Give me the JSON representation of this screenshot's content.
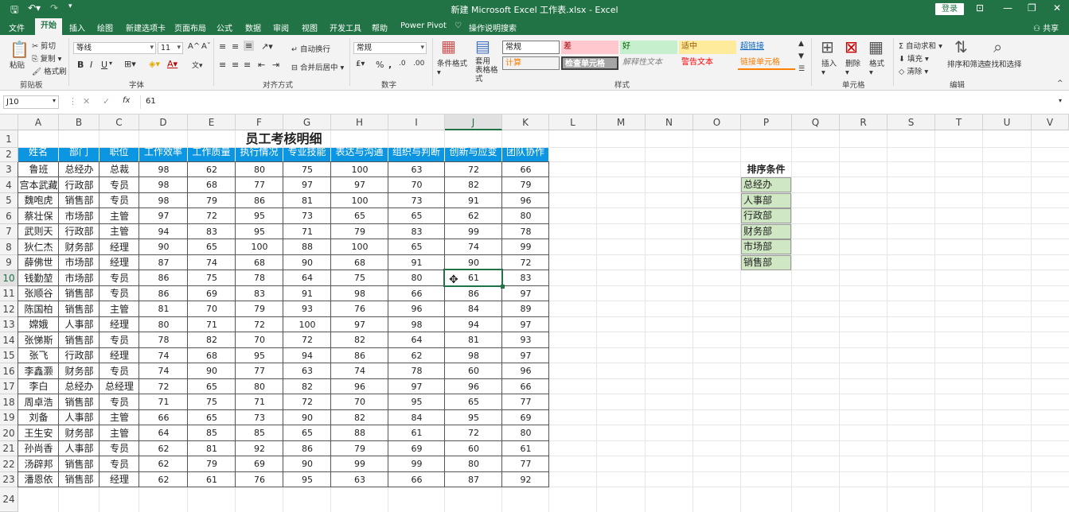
{
  "app": {
    "title": "新建 Microsoft Excel 工作表.xlsx - Excel",
    "signin": "登录",
    "share": "共享"
  },
  "menu": [
    "文件",
    "开始",
    "插入",
    "绘图",
    "新建选项卡",
    "页面布局",
    "公式",
    "数据",
    "审阅",
    "视图",
    "开发工具",
    "帮助",
    "Power Pivot",
    "操作说明搜索"
  ],
  "ribbon": {
    "clipboard": {
      "paste": "粘贴",
      "cut": "剪切",
      "copy": "复制",
      "painter": "格式刷",
      "label": "剪贴板"
    },
    "font": {
      "name": "等线",
      "size": "11",
      "label": "字体"
    },
    "align": {
      "wrap": "自动换行",
      "merge": "合并后居中",
      "label": "对齐方式"
    },
    "number": {
      "format": "常规",
      "label": "数字"
    },
    "styles": {
      "cond": "条件格式",
      "table": "套用\n表格格式",
      "cells": [
        "常规",
        "差",
        "好",
        "适中",
        "超链接",
        "计算",
        "检查单元格",
        "解释性文本",
        "警告文本",
        "链接单元格"
      ],
      "label": "样式"
    },
    "cellsgrp": {
      "insert": "插入",
      "delete": "删除",
      "format": "格式",
      "label": "单元格"
    },
    "editing": {
      "autosum": "自动求和",
      "fill": "填充",
      "clear": "清除",
      "sort": "排序和筛选",
      "find": "查找和选择",
      "label": "编辑"
    }
  },
  "namebox": "J10",
  "formula": "61",
  "columns": [
    "A",
    "B",
    "C",
    "D",
    "E",
    "F",
    "G",
    "H",
    "I",
    "J",
    "K",
    "L",
    "M",
    "N",
    "O",
    "P",
    "Q",
    "R",
    "S",
    "T",
    "U",
    "V"
  ],
  "title": "员工考核明细",
  "headers": [
    "姓名",
    "部门",
    "职位",
    "工作效率",
    "工作质量",
    "执行情况",
    "专业技能",
    "表达与沟通",
    "组织与判断",
    "创新与应变",
    "团队协作"
  ],
  "rows": [
    [
      "鲁班",
      "总经办",
      "总裁",
      "98",
      "62",
      "80",
      "75",
      "100",
      "63",
      "72",
      "66"
    ],
    [
      "宫本武藏",
      "行政部",
      "专员",
      "98",
      "68",
      "77",
      "97",
      "97",
      "70",
      "82",
      "79"
    ],
    [
      "魏咆虎",
      "销售部",
      "专员",
      "98",
      "79",
      "86",
      "81",
      "100",
      "73",
      "91",
      "96"
    ],
    [
      "蔡壮保",
      "市场部",
      "主管",
      "97",
      "72",
      "95",
      "73",
      "65",
      "65",
      "62",
      "80"
    ],
    [
      "武则天",
      "行政部",
      "主管",
      "94",
      "83",
      "95",
      "71",
      "79",
      "83",
      "99",
      "78"
    ],
    [
      "狄仁杰",
      "财务部",
      "经理",
      "90",
      "65",
      "100",
      "88",
      "100",
      "65",
      "74",
      "99"
    ],
    [
      "薛佛世",
      "市场部",
      "经理",
      "87",
      "74",
      "68",
      "90",
      "68",
      "91",
      "90",
      "72"
    ],
    [
      "钱勤堃",
      "市场部",
      "专员",
      "86",
      "75",
      "78",
      "64",
      "75",
      "80",
      "61",
      "83"
    ],
    [
      "张顺谷",
      "销售部",
      "专员",
      "86",
      "69",
      "83",
      "91",
      "98",
      "66",
      "86",
      "97"
    ],
    [
      "陈国柏",
      "销售部",
      "主管",
      "81",
      "70",
      "79",
      "93",
      "76",
      "96",
      "84",
      "89"
    ],
    [
      "嫦娥",
      "人事部",
      "经理",
      "80",
      "71",
      "72",
      "100",
      "97",
      "98",
      "94",
      "97"
    ],
    [
      "张悌斯",
      "销售部",
      "专员",
      "78",
      "82",
      "70",
      "72",
      "82",
      "64",
      "81",
      "93"
    ],
    [
      "张飞",
      "行政部",
      "经理",
      "74",
      "68",
      "95",
      "94",
      "86",
      "62",
      "98",
      "97"
    ],
    [
      "李鑫灏",
      "财务部",
      "专员",
      "74",
      "90",
      "77",
      "63",
      "74",
      "78",
      "60",
      "96"
    ],
    [
      "李白",
      "总经办",
      "总经理",
      "72",
      "65",
      "80",
      "82",
      "96",
      "97",
      "96",
      "66"
    ],
    [
      "周卓浩",
      "销售部",
      "专员",
      "71",
      "75",
      "71",
      "72",
      "70",
      "95",
      "65",
      "77"
    ],
    [
      "刘备",
      "人事部",
      "主管",
      "66",
      "65",
      "73",
      "90",
      "82",
      "84",
      "95",
      "69"
    ],
    [
      "王生安",
      "财务部",
      "主管",
      "64",
      "85",
      "85",
      "65",
      "88",
      "61",
      "72",
      "80"
    ],
    [
      "孙尚香",
      "人事部",
      "专员",
      "62",
      "81",
      "92",
      "86",
      "79",
      "69",
      "60",
      "61"
    ],
    [
      "汤辟邦",
      "销售部",
      "专员",
      "62",
      "79",
      "69",
      "90",
      "99",
      "99",
      "80",
      "77"
    ],
    [
      "潘恩依",
      "销售部",
      "经理",
      "62",
      "61",
      "76",
      "95",
      "63",
      "66",
      "87",
      "92"
    ]
  ],
  "sort_title": "排序条件",
  "sort_items": [
    "总经办",
    "人事部",
    "行政部",
    "财务部",
    "市场部",
    "销售部"
  ],
  "colors": {
    "brand": "#217346",
    "header": "#0c95e0",
    "sort_fill": "#cfe7c3"
  }
}
